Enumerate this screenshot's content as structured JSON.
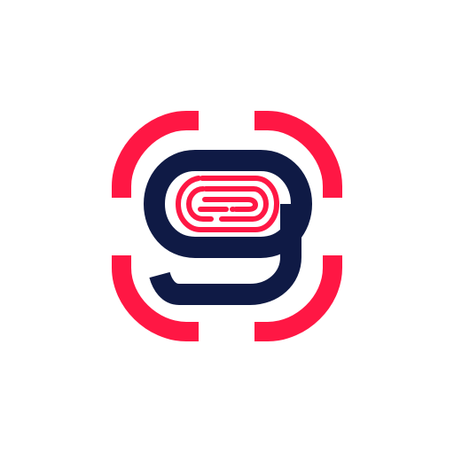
{
  "logo": {
    "name": "fingerprint-scan-g-logo",
    "colors": {
      "background": "#ffffff",
      "accent": "#ff1744",
      "primary": "#0f1a45"
    }
  }
}
